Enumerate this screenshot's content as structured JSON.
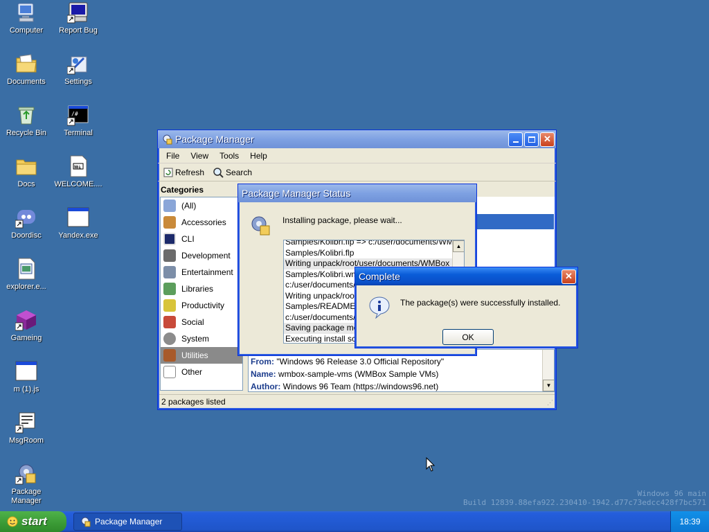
{
  "desktop": {
    "icons": [
      {
        "label": "Computer"
      },
      {
        "label": "Report Bug"
      },
      {
        "label": "Documents"
      },
      {
        "label": "Settings"
      },
      {
        "label": "Recycle Bin"
      },
      {
        "label": "Terminal"
      },
      {
        "label": "Docs"
      },
      {
        "label": "WELCOME...."
      },
      {
        "label": "Doordisc"
      },
      {
        "label": "Yandex.exe"
      },
      {
        "label": "explorer.e..."
      },
      {
        "label": "Gameing"
      },
      {
        "label": "m (1).js"
      },
      {
        "label": "MsgRoom"
      },
      {
        "label": "Package Manager"
      }
    ],
    "watermark": {
      "line1": "Windows 96 main",
      "line2": "Build 12839.88efa922.230410-1942.d77c73edcc428f7bc571"
    }
  },
  "package_manager": {
    "title": "Package Manager",
    "menu": [
      "File",
      "View",
      "Tools",
      "Help"
    ],
    "toolbar": {
      "refresh": "Refresh",
      "search": "Search"
    },
    "categories_header": "Categories",
    "categories": [
      {
        "label": "(All)",
        "color": "#8aa6d8"
      },
      {
        "label": "Accessories",
        "color": "#c98a3a"
      },
      {
        "label": "CLI",
        "color": "#1c2a6a"
      },
      {
        "label": "Development",
        "color": "#6b6b6b"
      },
      {
        "label": "Entertainment",
        "color": "#7c8ea8"
      },
      {
        "label": "Libraries",
        "color": "#5c9e5c"
      },
      {
        "label": "Productivity",
        "color": "#d8c43a"
      },
      {
        "label": "Social",
        "color": "#c84a3a"
      },
      {
        "label": "System",
        "color": "#8c8c8c"
      },
      {
        "label": "Utilities",
        "color": "#a85a2a"
      },
      {
        "label": "Other",
        "color": "#ffffff"
      }
    ],
    "selected_category": "Utilities",
    "details": {
      "from_label": "From:",
      "from_value": "\"Windows 96 Release 3.0 Official Repository\"",
      "name_label": "Name:",
      "name_value": "wmbox-sample-vms (WMBox Sample VMs)",
      "author_label": "Author:",
      "author_value": "Windows 96 Team (https://windows96.net)"
    },
    "status": "2 packages listed"
  },
  "status_dialog": {
    "title": "Package Manager Status",
    "message": "Installing package, please wait...",
    "log": [
      "Samples/Kolibri.flp => c:/user/documents/WMBox",
      "Samples/Kolibri.flp",
      "Writing unpack/root/user/documents/WMBox",
      "Samples/Kolibri.wmx =",
      "c:/user/documents/V",
      "Writing unpack/root/",
      "Samples/README.mc",
      "c:/user/documents/V",
      "Saving package meta",
      "Executing install script"
    ]
  },
  "complete_dialog": {
    "title": "Complete",
    "message": "The package(s) were successfully installed.",
    "ok": "OK"
  },
  "taskbar": {
    "start": "start",
    "task": "Package Manager",
    "clock": "18:39"
  }
}
